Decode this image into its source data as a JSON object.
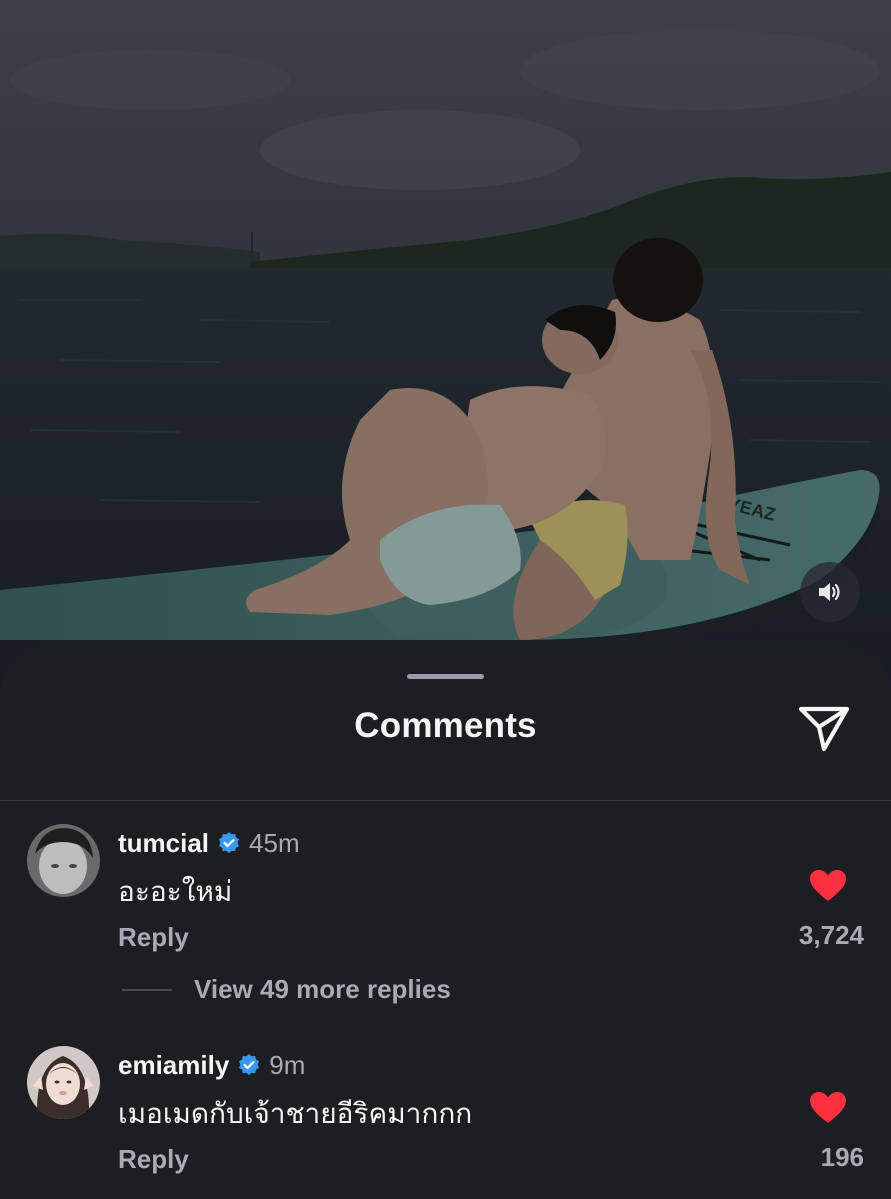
{
  "post": {
    "photo": {
      "description_icon": "photo-two-people-on-paddleboard",
      "board_brand": "@YEAZ"
    },
    "sound_icon": "speaker-icon"
  },
  "sheet": {
    "title": "Comments",
    "share_icon": "send-icon"
  },
  "comments": [
    {
      "username": "tumcial",
      "verified": true,
      "time": "45m",
      "text": "อะอะใหม่",
      "reply_label": "Reply",
      "likes": "3,724",
      "liked": true,
      "view_replies_label": "View 49 more replies"
    },
    {
      "username": "emiamily",
      "verified": true,
      "time": "9m",
      "text": "เมอเมดกับเจ้าชายอีริคมากกก",
      "reply_label": "Reply",
      "likes": "196",
      "liked": true
    }
  ],
  "colors": {
    "sheet_bg": "#1c1e22",
    "text_primary": "#f5f5f5",
    "text_secondary": "#a8abb1",
    "verified_blue": "#3897f0",
    "like_red": "#ff3040"
  }
}
